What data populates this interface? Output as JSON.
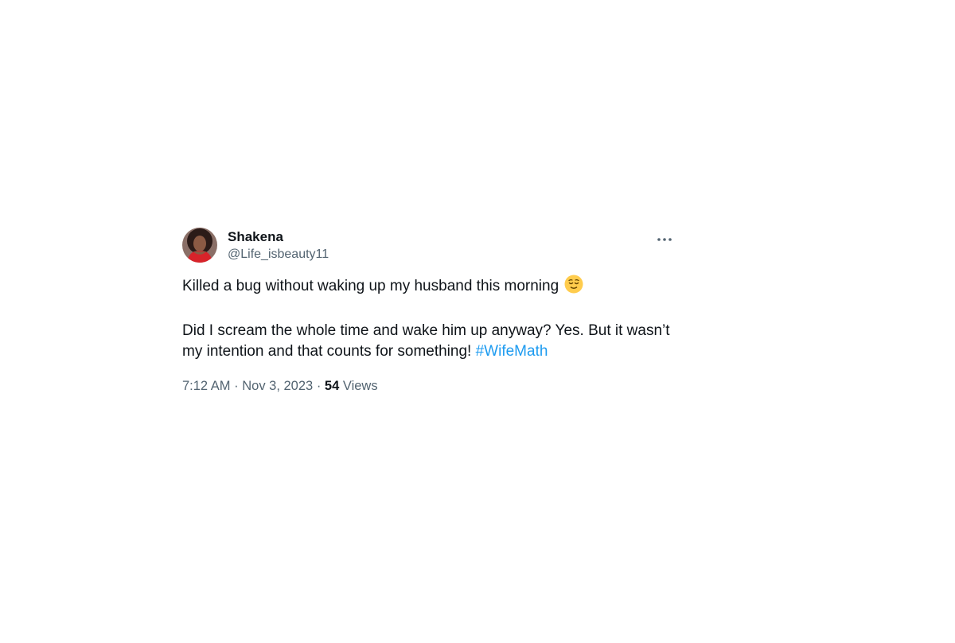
{
  "tweet": {
    "author": {
      "display_name": "Shakena",
      "handle": "@Life_isbeauty11",
      "avatar_icon": "profile-photo"
    },
    "more_icon": "more-horizontal-icon",
    "text_line_1": "Killed a bug without waking up my husband this morning",
    "emoji": "relieved-face-emoji",
    "text_line_2": "Did I scream the whole time and wake him up anyway? Yes. But it wasn’t my intention and that counts for something!",
    "hashtag": "#WifeMath",
    "time": "7:12 AM",
    "separator": "·",
    "date": "Nov 3, 2023",
    "views_count": "54",
    "views_label": "Views"
  },
  "colors": {
    "text": "#0f1419",
    "secondary": "#536471",
    "link": "#1d9bf0"
  }
}
